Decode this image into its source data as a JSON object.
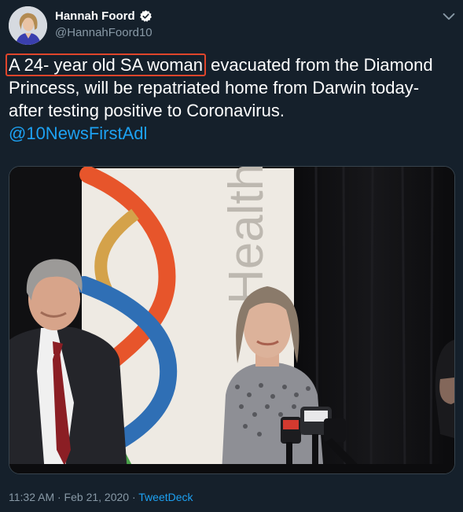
{
  "author": {
    "name": "Hannah Foord",
    "handle": "@HannahFoord10",
    "verified": true
  },
  "tweet": {
    "text_highlighted": "A 24- year old SA woman",
    "text_rest": " evacuated from the Diamond Princess, will be repatriated home from Darwin today- after testing positive to Coronavirus.",
    "mention": "@10NewsFirstAdl"
  },
  "media": {
    "sign_text": "Health"
  },
  "meta": {
    "timestamp": "11:32 AM · Feb 21, 2020",
    "separator": "·",
    "source": "TweetDeck"
  },
  "colors": {
    "background": "#15202b",
    "link": "#1da1f2",
    "highlight_box": "#e0452b",
    "muted": "#8899a6"
  }
}
